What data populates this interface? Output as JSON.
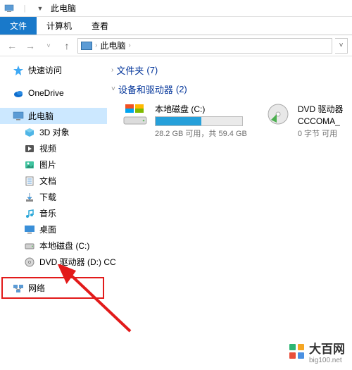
{
  "title": "此电脑",
  "menu": {
    "file": "文件",
    "computer": "计算机",
    "view": "查看"
  },
  "address": {
    "location": "此电脑"
  },
  "sidebar": {
    "quick_access": "快速访问",
    "onedrive": "OneDrive",
    "this_pc": "此电脑",
    "items": [
      "3D 对象",
      "视频",
      "图片",
      "文档",
      "下载",
      "音乐",
      "桌面",
      "本地磁盘 (C:)",
      "DVD 驱动器 (D:) CC"
    ],
    "network": "网络"
  },
  "sections": {
    "folders": {
      "label": "文件夹",
      "count": "(7)"
    },
    "devices": {
      "label": "设备和驱动器",
      "count": "(2)"
    }
  },
  "drives": {
    "c": {
      "name": "本地磁盘 (C:)",
      "free": "28.2 GB 可用，共 59.4 GB",
      "fill_pct": 53
    },
    "dvd": {
      "name": "DVD 驱动器",
      "sub": "CCCOMA_",
      "stats": "0 字节 可用"
    }
  },
  "watermark": {
    "brand": "大百网",
    "url": "big100.net"
  }
}
